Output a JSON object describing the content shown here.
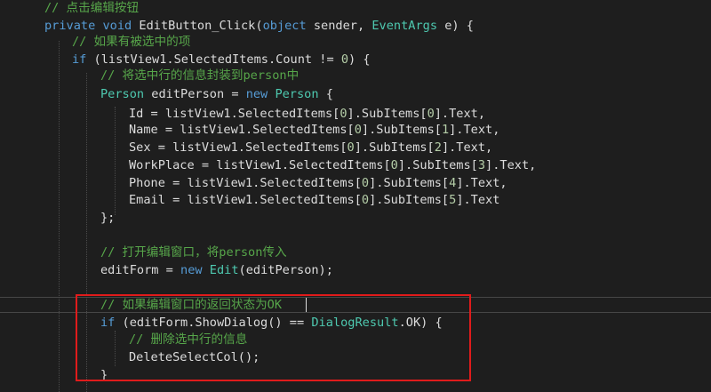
{
  "colors": {
    "background": "#1e1e1e",
    "keyword": "#569cd6",
    "type": "#4ec9b0",
    "comment": "#57a64a",
    "number": "#b5cea8",
    "plain": "#dcdcdc",
    "highlight_box": "#e01b1b"
  },
  "code": {
    "lines": [
      [
        {
          "c": "cm",
          "t": "// 点击编辑按钮"
        }
      ],
      [
        {
          "c": "kw",
          "t": "private"
        },
        {
          "c": "pl",
          "t": " "
        },
        {
          "c": "kw",
          "t": "void"
        },
        {
          "c": "pl",
          "t": " EditButton_Click("
        },
        {
          "c": "kw",
          "t": "object"
        },
        {
          "c": "pl",
          "t": " sender, "
        },
        {
          "c": "ty",
          "t": "EventArgs"
        },
        {
          "c": "pl",
          "t": " e) {"
        }
      ],
      [
        {
          "c": "cm",
          "t": "// 如果有被选中的项"
        }
      ],
      [
        {
          "c": "kw",
          "t": "if"
        },
        {
          "c": "pl",
          "t": " (listView1.SelectedItems.Count != "
        },
        {
          "c": "nm",
          "t": "0"
        },
        {
          "c": "pl",
          "t": ") {"
        }
      ],
      [
        {
          "c": "cm",
          "t": "// 将选中行的信息封装到person中"
        }
      ],
      [
        {
          "c": "ty",
          "t": "Person"
        },
        {
          "c": "pl",
          "t": " editPerson = "
        },
        {
          "c": "kw",
          "t": "new"
        },
        {
          "c": "pl",
          "t": " "
        },
        {
          "c": "ty",
          "t": "Person"
        },
        {
          "c": "pl",
          "t": " {"
        }
      ],
      [
        {
          "c": "pl",
          "t": "Id = listView1.SelectedItems["
        },
        {
          "c": "nm",
          "t": "0"
        },
        {
          "c": "pl",
          "t": "].SubItems["
        },
        {
          "c": "nm",
          "t": "0"
        },
        {
          "c": "pl",
          "t": "].Text,"
        }
      ],
      [
        {
          "c": "pl",
          "t": "Name = listView1.SelectedItems["
        },
        {
          "c": "nm",
          "t": "0"
        },
        {
          "c": "pl",
          "t": "].SubItems["
        },
        {
          "c": "nm",
          "t": "1"
        },
        {
          "c": "pl",
          "t": "].Text,"
        }
      ],
      [
        {
          "c": "pl",
          "t": "Sex = listView1.SelectedItems["
        },
        {
          "c": "nm",
          "t": "0"
        },
        {
          "c": "pl",
          "t": "].SubItems["
        },
        {
          "c": "nm",
          "t": "2"
        },
        {
          "c": "pl",
          "t": "].Text,"
        }
      ],
      [
        {
          "c": "pl",
          "t": "WorkPlace = listView1.SelectedItems["
        },
        {
          "c": "nm",
          "t": "0"
        },
        {
          "c": "pl",
          "t": "].SubItems["
        },
        {
          "c": "nm",
          "t": "3"
        },
        {
          "c": "pl",
          "t": "].Text,"
        }
      ],
      [
        {
          "c": "pl",
          "t": "Phone = listView1.SelectedItems["
        },
        {
          "c": "nm",
          "t": "0"
        },
        {
          "c": "pl",
          "t": "].SubItems["
        },
        {
          "c": "nm",
          "t": "4"
        },
        {
          "c": "pl",
          "t": "].Text,"
        }
      ],
      [
        {
          "c": "pl",
          "t": "Email = listView1.SelectedItems["
        },
        {
          "c": "nm",
          "t": "0"
        },
        {
          "c": "pl",
          "t": "].SubItems["
        },
        {
          "c": "nm",
          "t": "5"
        },
        {
          "c": "pl",
          "t": "].Text"
        }
      ],
      [
        {
          "c": "pl",
          "t": "};"
        }
      ],
      [],
      [
        {
          "c": "cm",
          "t": "// 打开编辑窗口，将person传入"
        }
      ],
      [
        {
          "c": "pl",
          "t": "editForm = "
        },
        {
          "c": "kw",
          "t": "new"
        },
        {
          "c": "pl",
          "t": " "
        },
        {
          "c": "ty",
          "t": "Edit"
        },
        {
          "c": "pl",
          "t": "(editPerson);"
        }
      ],
      [],
      [
        {
          "c": "cm",
          "t": "// 如果编辑窗口的返回状态为OK"
        }
      ],
      [
        {
          "c": "kw",
          "t": "if"
        },
        {
          "c": "pl",
          "t": " (editForm.ShowDialog() == "
        },
        {
          "c": "ty",
          "t": "DialogResult"
        },
        {
          "c": "pl",
          "t": ".OK) {"
        }
      ],
      [
        {
          "c": "cm",
          "t": "// 删除选中行的信息"
        }
      ],
      [
        {
          "c": "pl",
          "t": "DeleteSelectCol();"
        }
      ],
      [
        {
          "c": "pl",
          "t": "}"
        }
      ]
    ]
  }
}
